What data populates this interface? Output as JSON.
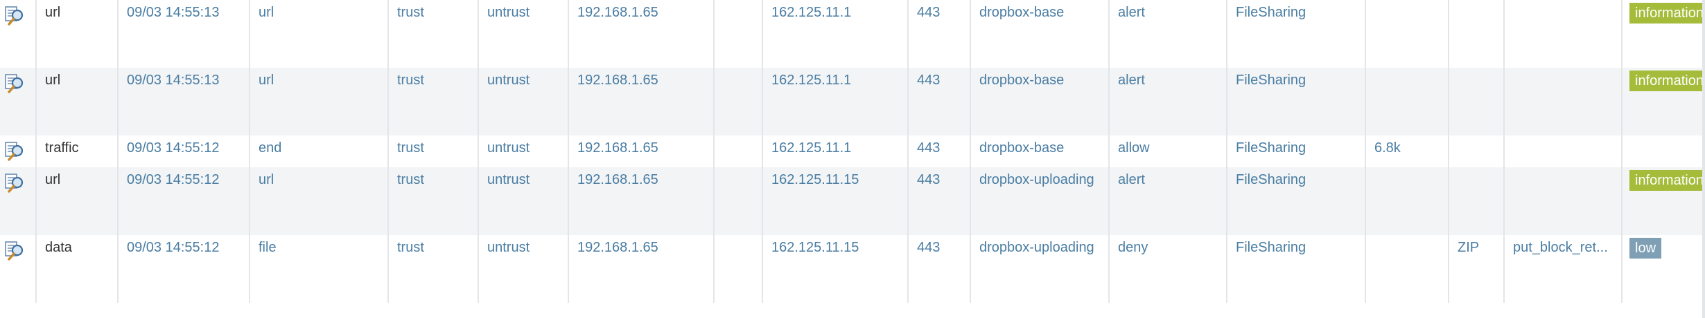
{
  "colors": {
    "link_text": "#4a7da3",
    "plain_text": "#333333",
    "row_alt_bg": "#f2f4f6",
    "severity_information": "#a5bb3a",
    "severity_low": "#7f9fb4"
  },
  "rows": [
    {
      "icon": "log-detail-magnifier-icon",
      "type": "url",
      "receive_time": "09/03 14:55:13",
      "subtype": "url",
      "from_zone": "trust",
      "to_zone": "untrust",
      "source": "192.168.1.65",
      "source_user": "",
      "destination": "162.125.11.1",
      "dst_port": "443",
      "application": "dropbox-base",
      "action": "alert",
      "category": "FileSharing",
      "bytes": "",
      "file_type": "",
      "file_name": "",
      "severity": "informational"
    },
    {
      "icon": "log-detail-magnifier-icon",
      "type": "url",
      "receive_time": "09/03 14:55:13",
      "subtype": "url",
      "from_zone": "trust",
      "to_zone": "untrust",
      "source": "192.168.1.65",
      "source_user": "",
      "destination": "162.125.11.1",
      "dst_port": "443",
      "application": "dropbox-base",
      "action": "alert",
      "category": "FileSharing",
      "bytes": "",
      "file_type": "",
      "file_name": "",
      "severity": "informational"
    },
    {
      "icon": "log-detail-magnifier-icon",
      "type": "traffic",
      "receive_time": "09/03 14:55:12",
      "subtype": "end",
      "from_zone": "trust",
      "to_zone": "untrust",
      "source": "192.168.1.65",
      "source_user": "",
      "destination": "162.125.11.1",
      "dst_port": "443",
      "application": "dropbox-base",
      "action": "allow",
      "category": "FileSharing",
      "bytes": "6.8k",
      "file_type": "",
      "file_name": "",
      "severity": ""
    },
    {
      "icon": "log-detail-magnifier-icon",
      "type": "url",
      "receive_time": "09/03 14:55:12",
      "subtype": "url",
      "from_zone": "trust",
      "to_zone": "untrust",
      "source": "192.168.1.65",
      "source_user": "",
      "destination": "162.125.11.15",
      "dst_port": "443",
      "application": "dropbox-uploading",
      "action": "alert",
      "category": "FileSharing",
      "bytes": "",
      "file_type": "",
      "file_name": "",
      "severity": "informational"
    },
    {
      "icon": "log-detail-magnifier-icon",
      "type": "data",
      "receive_time": "09/03 14:55:12",
      "subtype": "file",
      "from_zone": "trust",
      "to_zone": "untrust",
      "source": "192.168.1.65",
      "source_user": "",
      "destination": "162.125.11.15",
      "dst_port": "443",
      "application": "dropbox-uploading",
      "action": "deny",
      "category": "FileSharing",
      "bytes": "",
      "file_type": "ZIP",
      "file_name": "put_block_ret...",
      "severity": "low"
    }
  ]
}
